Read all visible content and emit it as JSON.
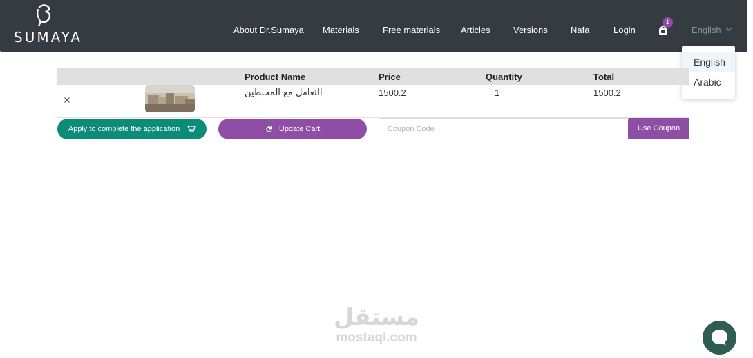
{
  "brand": {
    "logo_text": "SUMAYA"
  },
  "nav": {
    "items": [
      {
        "label": "About Dr.Sumaya"
      },
      {
        "label": "Materials"
      },
      {
        "label": "Free materials"
      },
      {
        "label": "Articles"
      },
      {
        "label": "Versions"
      },
      {
        "label": "Nafa"
      },
      {
        "label": "Login"
      }
    ],
    "cart_count": "1",
    "language": "English"
  },
  "language_menu": {
    "options": [
      "English",
      "Arabic"
    ],
    "selected": "English"
  },
  "cart_table": {
    "headers": [
      "Product Name",
      "Price",
      "Quantity",
      "Total"
    ],
    "rows": [
      {
        "product_name": "التعامل مع المحبطين",
        "price": "1500.2",
        "quantity": "1",
        "total": "1500.2"
      }
    ]
  },
  "actions": {
    "apply_label": "Apply to complete the application",
    "update_label": "Update Cart",
    "coupon_placeholder": "Coupon Code",
    "coupon_value": "",
    "use_coupon_label": "Use Coupon"
  },
  "watermark": {
    "arabic": "مستقل",
    "latin": "mostaql.com"
  },
  "colors": {
    "navbar": "#343c42",
    "accent_purple": "#8e4ea6",
    "accent_green": "#0b8c78",
    "chat": "#2f5d52"
  }
}
